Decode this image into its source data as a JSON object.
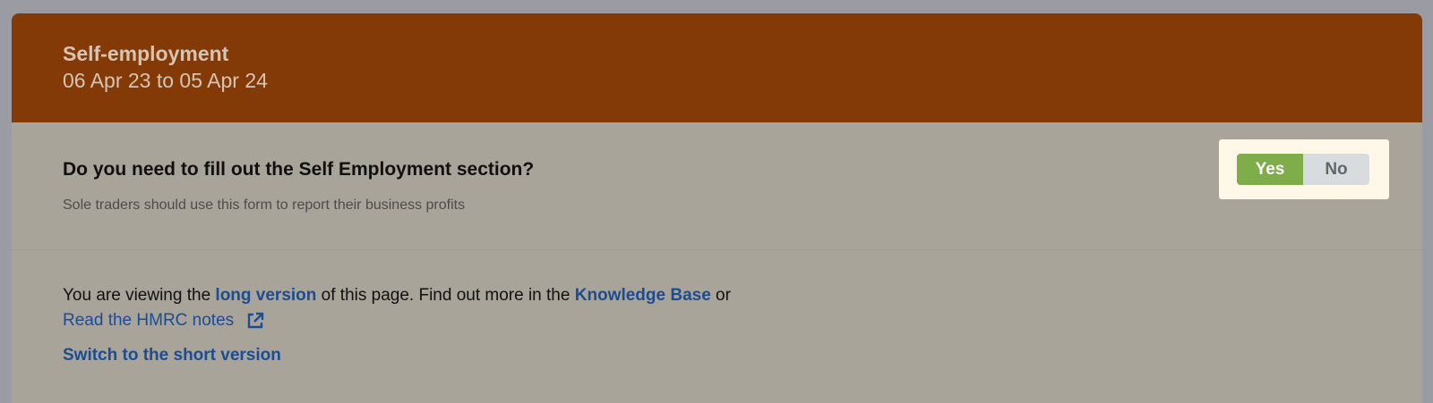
{
  "header": {
    "title": "Self-employment",
    "dates": "06 Apr 23 to 05 Apr 24"
  },
  "question": {
    "text": "Do you need to fill out the Self Employment section?",
    "hint": "Sole traders should use this form to report their business profits",
    "toggle": {
      "yes_label": "Yes",
      "no_label": "No",
      "selected": "Yes"
    }
  },
  "info": {
    "prefix": "You are viewing the ",
    "long_version_link": "long version",
    "middle": " of this page. Find out more in the ",
    "kb_link": "Knowledge Base",
    "suffix": " or",
    "hmrc_link": "Read the HMRC notes",
    "switch_link": "Switch to the short version"
  },
  "colors": {
    "header_bg": "#833a07",
    "card_bg": "#a8a499",
    "link": "#1c4c94",
    "yes_selected": "#7fad4a",
    "toggle_highlight": "#fff8e8"
  },
  "icons": {
    "external_link": "external-link-icon"
  }
}
